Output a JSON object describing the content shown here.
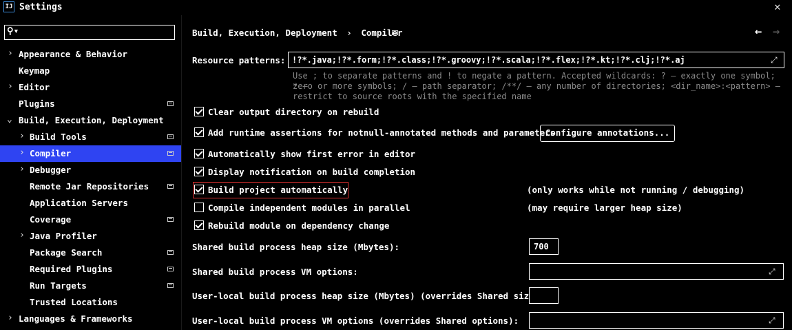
{
  "window": {
    "title": "Settings",
    "app_icon": "IJ"
  },
  "search": {
    "value": "",
    "placeholder": ""
  },
  "sidebar": {
    "items": [
      {
        "label": "Appearance & Behavior"
      },
      {
        "label": "Keymap"
      },
      {
        "label": "Editor"
      },
      {
        "label": "Plugins"
      },
      {
        "label": "Build, Execution, Deployment"
      },
      {
        "label": "Build Tools"
      },
      {
        "label": "Compiler"
      },
      {
        "label": "Debugger"
      },
      {
        "label": "Remote Jar Repositories"
      },
      {
        "label": "Application Servers"
      },
      {
        "label": "Coverage"
      },
      {
        "label": "Java Profiler"
      },
      {
        "label": "Package Search"
      },
      {
        "label": "Required Plugins"
      },
      {
        "label": "Run Targets"
      },
      {
        "label": "Trusted Locations"
      },
      {
        "label": "Languages & Frameworks"
      }
    ]
  },
  "breadcrumb": {
    "parent": "Build, Execution, Deployment",
    "separator": "›",
    "current": "Compiler"
  },
  "resource": {
    "label": "Resource patterns:",
    "value": "!?*.java;!?*.form;!?*.class;!?*.groovy;!?*.scala;!?*.flex;!?*.kt;!?*.clj;!?*.aj",
    "hint_line1": "Use ; to separate patterns and ! to negate a pattern. Accepted wildcards: ? — exactly one symbol; * —",
    "hint_line2": "zero or more symbols; / — path separator; /**/ — any number of directories; <dir_name>:<pattern> —",
    "hint_line3": "restrict to source roots with the specified name"
  },
  "options": {
    "clear_output": {
      "label": "Clear output directory on rebuild",
      "checked": true
    },
    "runtime_assertions": {
      "label": "Add runtime assertions for notnull-annotated methods and parameters",
      "checked": true
    },
    "configure_annotations": "Configure annotations...",
    "show_first_error": {
      "label": "Automatically show first error in editor",
      "checked": true
    },
    "notify_build": {
      "label": "Display notification on build completion",
      "checked": true
    },
    "build_auto": {
      "label": "Build project automatically",
      "checked": true,
      "note": "(only works while not running / debugging)"
    },
    "compile_parallel": {
      "label": "Compile independent modules in parallel",
      "checked": false,
      "note": "(may require larger heap size)"
    },
    "rebuild_dependency": {
      "label": "Rebuild module on dependency change",
      "checked": true
    }
  },
  "heap": {
    "label": "Shared build process heap size (Mbytes):",
    "value": "700"
  },
  "vm_options": {
    "label": "Shared build process VM options:",
    "value": ""
  },
  "local_heap": {
    "label": "User-local build process heap size (Mbytes) (overrides Shared size):",
    "value": ""
  },
  "local_vm": {
    "label": "User-local build process VM options (overrides Shared options):",
    "value": ""
  },
  "colors": {
    "selection": "#2f44f2",
    "highlight": "#e03131",
    "hint": "#8a8a8a"
  }
}
